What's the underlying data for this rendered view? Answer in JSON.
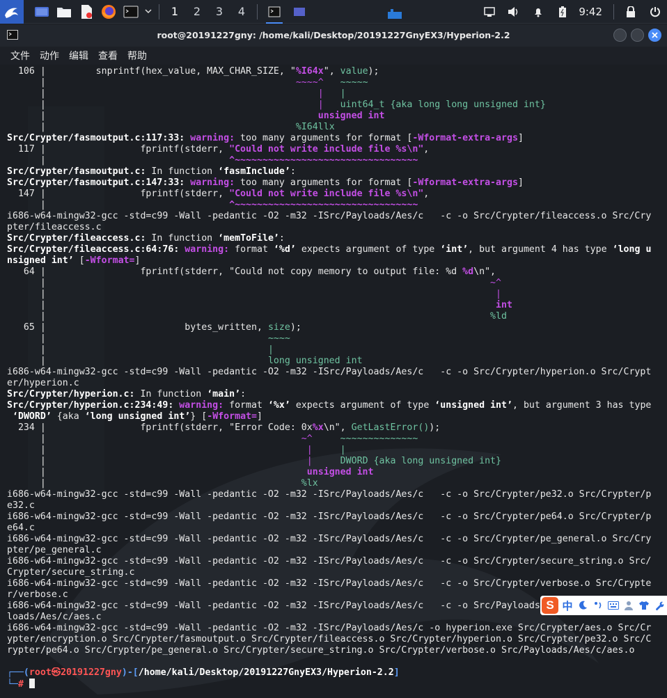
{
  "taskbar": {
    "workspaces": [
      "1",
      "2",
      "3",
      "4"
    ],
    "clock": "9:42"
  },
  "window": {
    "title": "root@20191227gny: /home/kali/Desktop/20191227GnyEX3/Hyperion-2.2",
    "menu": [
      "文件",
      "动作",
      "编辑",
      "查看",
      "帮助"
    ]
  },
  "terminal": {
    "lines": [
      [
        {
          "t": "  106 |         snprintf(hex_value, MAX_CHAR_SIZE, \""
        },
        {
          "t": "%I64x",
          "c": "w"
        },
        {
          "t": "\", "
        },
        {
          "t": "value",
          "c": "grn"
        },
        {
          "t": ");"
        }
      ],
      [
        {
          "t": "      |                                             "
        },
        {
          "t": "~~~~^",
          "c": "mg"
        },
        {
          "t": "   "
        },
        {
          "t": "~~~~~",
          "c": "grn"
        }
      ],
      [
        {
          "t": "      |                                                 "
        },
        {
          "t": "|",
          "c": "mg"
        },
        {
          "t": "   "
        },
        {
          "t": "|",
          "c": "grn"
        }
      ],
      [
        {
          "t": "      |                                                 "
        },
        {
          "t": "|",
          "c": "mg"
        },
        {
          "t": "   "
        },
        {
          "t": "uint64_t {aka long long unsigned int}",
          "c": "grn"
        }
      ],
      [
        {
          "t": "      |                                                 "
        },
        {
          "t": "unsigned int",
          "c": "bp"
        }
      ],
      [
        {
          "t": "      |                                             "
        },
        {
          "t": "%I64llx",
          "c": "grn"
        }
      ],
      [
        {
          "t": "Src/Crypter/fasmoutput.c:117:33: ",
          "c": "b"
        },
        {
          "t": "warning:",
          "c": "w"
        },
        {
          "t": " too many arguments for format ["
        },
        {
          "t": "-Wformat-extra-args",
          "c": "w"
        },
        {
          "t": "]"
        }
      ],
      [
        {
          "t": "  117 |                 fprintf(stderr, "
        },
        {
          "t": "\"Could not write include file %s\\n\"",
          "c": "w"
        },
        {
          "t": ","
        }
      ],
      [
        {
          "t": "      |                                 "
        },
        {
          "t": "^~~~~~~~~~~~~~~~~~~~~~~~~~~~~~~~~~",
          "c": "w"
        }
      ],
      [
        {
          "t": "Src/Crypter/fasmoutput.c:",
          "c": "b"
        },
        {
          "t": " In function "
        },
        {
          "t": "‘fasmInclude’",
          "c": "b"
        },
        {
          "t": ":"
        }
      ],
      [
        {
          "t": "Src/Crypter/fasmoutput.c:147:33: ",
          "c": "b"
        },
        {
          "t": "warning:",
          "c": "w"
        },
        {
          "t": " too many arguments for format ["
        },
        {
          "t": "-Wformat-extra-args",
          "c": "w"
        },
        {
          "t": "]"
        }
      ],
      [
        {
          "t": "  147 |                 fprintf(stderr, "
        },
        {
          "t": "\"Could not write include file %s\\n\"",
          "c": "w"
        },
        {
          "t": ","
        }
      ],
      [
        {
          "t": "      |                                 "
        },
        {
          "t": "^~~~~~~~~~~~~~~~~~~~~~~~~~~~~~~~~~",
          "c": "w"
        }
      ],
      [
        {
          "t": "i686-w64-mingw32-gcc -std=c99 -Wall -pedantic -O2 -m32 -ISrc/Payloads/Aes/c   -c -o Src/Crypter/fileaccess.o Src/Cry"
        }
      ],
      [
        {
          "t": "pter/fileaccess.c"
        }
      ],
      [
        {
          "t": "Src/Crypter/fileaccess.c:",
          "c": "b"
        },
        {
          "t": " In function "
        },
        {
          "t": "‘memToFile’",
          "c": "b"
        },
        {
          "t": ":"
        }
      ],
      [
        {
          "t": "Src/Crypter/fileaccess.c:64:76: ",
          "c": "b"
        },
        {
          "t": "warning:",
          "c": "w"
        },
        {
          "t": " format "
        },
        {
          "t": "‘%d’",
          "c": "b"
        },
        {
          "t": " expects argument of type "
        },
        {
          "t": "‘int’",
          "c": "b"
        },
        {
          "t": ", but argument 4 has type "
        },
        {
          "t": "‘long u",
          "c": "b"
        }
      ],
      [
        {
          "t": "nsigned int’",
          "c": "b"
        },
        {
          "t": " ["
        },
        {
          "t": "-Wformat=",
          "c": "w"
        },
        {
          "t": "]"
        }
      ],
      [
        {
          "t": "   64 |                 fprintf(stderr, \"Could not copy memory to output file: %d "
        },
        {
          "t": "%d",
          "c": "w"
        },
        {
          "t": "\\n\","
        }
      ],
      [
        {
          "t": "      |                                                                                "
        },
        {
          "t": "~^",
          "c": "mg"
        }
      ],
      [
        {
          "t": "      |                                                                                 "
        },
        {
          "t": "|",
          "c": "mg"
        }
      ],
      [
        {
          "t": "      |                                                                                 "
        },
        {
          "t": "int",
          "c": "bp"
        }
      ],
      [
        {
          "t": "      |                                                                                "
        },
        {
          "t": "%ld",
          "c": "grn"
        }
      ],
      [
        {
          "t": "   65 |                         bytes_written, "
        },
        {
          "t": "size",
          "c": "grn"
        },
        {
          "t": ");"
        }
      ],
      [
        {
          "t": "      |                                        "
        },
        {
          "t": "~~~~",
          "c": "grn"
        }
      ],
      [
        {
          "t": "      |                                        "
        },
        {
          "t": "|",
          "c": "grn"
        }
      ],
      [
        {
          "t": "      |                                        "
        },
        {
          "t": "long unsigned int",
          "c": "grn"
        }
      ],
      [
        {
          "t": "i686-w64-mingw32-gcc -std=c99 -Wall -pedantic -O2 -m32 -ISrc/Payloads/Aes/c   -c -o Src/Crypter/hyperion.o Src/Crypt"
        }
      ],
      [
        {
          "t": "er/hyperion.c"
        }
      ],
      [
        {
          "t": "Src/Crypter/hyperion.c:",
          "c": "b"
        },
        {
          "t": " In function "
        },
        {
          "t": "‘main’",
          "c": "b"
        },
        {
          "t": ":"
        }
      ],
      [
        {
          "t": "Src/Crypter/hyperion.c:234:49: ",
          "c": "b"
        },
        {
          "t": "warning:",
          "c": "w"
        },
        {
          "t": " format "
        },
        {
          "t": "‘%x’",
          "c": "b"
        },
        {
          "t": " expects argument of type "
        },
        {
          "t": "‘unsigned int’",
          "c": "b"
        },
        {
          "t": ", but argument 3 has type"
        }
      ],
      [
        {
          "t": " "
        },
        {
          "t": "‘DWORD’",
          "c": "b"
        },
        {
          "t": " {aka "
        },
        {
          "t": "‘long unsigned int’",
          "c": "b"
        },
        {
          "t": "} ["
        },
        {
          "t": "-Wformat=",
          "c": "w"
        },
        {
          "t": "]"
        }
      ],
      [
        {
          "t": "  234 |                 fprintf(stderr, \"Error Code: 0x"
        },
        {
          "t": "%x",
          "c": "w"
        },
        {
          "t": "\\n\", "
        },
        {
          "t": "GetLastError()",
          "c": "grn"
        },
        {
          "t": ");"
        }
      ],
      [
        {
          "t": "      |                                              "
        },
        {
          "t": "~^",
          "c": "mg"
        },
        {
          "t": "     "
        },
        {
          "t": "~~~~~~~~~~~~~~",
          "c": "grn"
        }
      ],
      [
        {
          "t": "      |                                               "
        },
        {
          "t": "|",
          "c": "mg"
        },
        {
          "t": "     "
        },
        {
          "t": "|",
          "c": "grn"
        }
      ],
      [
        {
          "t": "      |                                               "
        },
        {
          "t": "|",
          "c": "mg"
        },
        {
          "t": "     "
        },
        {
          "t": "DWORD {aka long unsigned int}",
          "c": "grn"
        }
      ],
      [
        {
          "t": "      |                                               "
        },
        {
          "t": "unsigned int",
          "c": "bp"
        }
      ],
      [
        {
          "t": "      |                                              "
        },
        {
          "t": "%lx",
          "c": "grn"
        }
      ],
      [
        {
          "t": "i686-w64-mingw32-gcc -std=c99 -Wall -pedantic -O2 -m32 -ISrc/Payloads/Aes/c   -c -o Src/Crypter/pe32.o Src/Crypter/p"
        }
      ],
      [
        {
          "t": "e32.c"
        }
      ],
      [
        {
          "t": "i686-w64-mingw32-gcc -std=c99 -Wall -pedantic -O2 -m32 -ISrc/Payloads/Aes/c   -c -o Src/Crypter/pe64.o Src/Crypter/p"
        }
      ],
      [
        {
          "t": "e64.c"
        }
      ],
      [
        {
          "t": "i686-w64-mingw32-gcc -std=c99 -Wall -pedantic -O2 -m32 -ISrc/Payloads/Aes/c   -c -o Src/Crypter/pe_general.o Src/Cry"
        }
      ],
      [
        {
          "t": "pter/pe_general.c"
        }
      ],
      [
        {
          "t": "i686-w64-mingw32-gcc -std=c99 -Wall -pedantic -O2 -m32 -ISrc/Payloads/Aes/c   -c -o Src/Crypter/secure_string.o Src/"
        }
      ],
      [
        {
          "t": "Crypter/secure_string.c"
        }
      ],
      [
        {
          "t": "i686-w64-mingw32-gcc -std=c99 -Wall -pedantic -O2 -m32 -ISrc/Payloads/Aes/c   -c -o Src/Crypter/verbose.o Src/Crypte"
        }
      ],
      [
        {
          "t": "r/verbose.c"
        }
      ],
      [
        {
          "t": "i686-w64-mingw32-gcc -std=c99 -Wall -pedantic -O2 -m32 -ISrc/Payloads/Aes/c   -c -o Src/Payloads"
        }
      ],
      [
        {
          "t": "loads/Aes/c/aes.c"
        }
      ],
      [
        {
          "t": "i686-w64-mingw32-gcc -std=c99 -Wall -pedantic -O2 -m32 -ISrc/Payloads/Aes/c -o hyperion.exe Src/Crypter/aes.o Src/Cr"
        }
      ],
      [
        {
          "t": "ypter/encryption.o Src/Crypter/fasmoutput.o Src/Crypter/fileaccess.o Src/Crypter/hyperion.o Src/Crypter/pe32.o Src/C"
        }
      ],
      [
        {
          "t": "rypter/pe64.o Src/Crypter/pe_general.o Src/Crypter/secure_string.o Src/Crypter/verbose.o Src/Payloads/Aes/c/aes.o"
        }
      ],
      [
        {
          "t": ""
        }
      ]
    ],
    "prompt": {
      "prefix": "┌──(",
      "user": "root㉿20191227gny",
      "mid": ")-[",
      "path": "/home/kali/Desktop/20191227GnyEX3/Hyperion-2.2",
      "suffix": "]",
      "line2": "└─",
      "symbol": "#"
    }
  },
  "ime": {
    "logo": "S",
    "mode": "中"
  },
  "colors": {
    "accent": "#4b8cf7",
    "warning": "#c44fe6",
    "fixit": "#6fc3a1",
    "prompt_path": "#5c9cf5",
    "prompt_user": "#ff5555"
  }
}
